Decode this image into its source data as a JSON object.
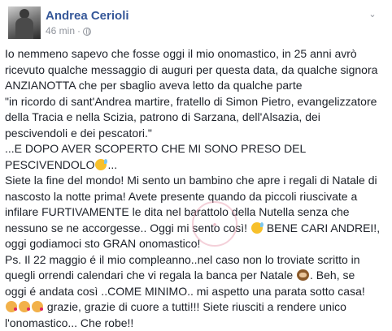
{
  "author": {
    "name": "Andrea Cerioli"
  },
  "meta": {
    "time": "46 min",
    "separator": "·",
    "privacy_icon": "globe-icon"
  },
  "menu": {
    "icon": "chevron-down-icon"
  },
  "post": {
    "lines": [
      "Io nemmeno sapevo che fosse oggi il mio onomastico, in 25 anni avrò",
      "ricevuto qualche messaggio di auguri per questa data, da qualche signora",
      "ANZIANOTTA che per sbaglio aveva letto da qualche parte",
      "\"in ricordo di sant'Andrea martire, fratello di Simon Pietro, evangelizzatore",
      "della Tracia e nella Scizia, patrono di Sarzana, dell'Alsazia, dei",
      "pescivendoli e dei pescatori.\"",
      "...E DOPO AVER SCOPERTO CHE MI SONO PRESO DEL",
      {
        "before": "PESCIVENDOLO",
        "emoji": "sweat-smile-emoji",
        "after": "..."
      },
      "Siete la fine del mondo! Mi sento un bambino che apre i regali di Natale di",
      "nascosto la notte prima! Avete presente quando da piccoli riuscivate a",
      "infilare FURTIVAMENTE le dita nel barattolo della Nutella senza che",
      {
        "before": "nessuno se ne accorgesse.. Oggi mi sento così! ",
        "emoji": "sweat-smile-emoji",
        "after": " BENE CARI ANDREI!,"
      },
      "oggi godiamoci sto GRAN onomastico!",
      "Ps. Il 22 maggio é il mio compleanno..nel caso non lo troviate scritto in",
      {
        "before": "quegli orrendi calendari che vi regala la banca per Natale ",
        "emoji": "see-no-evil-monkey-emoji",
        "after": ". Beh, se"
      },
      "oggi é andata così ..COME MINIMO.. mi aspetto una parata sotto casa!",
      {
        "before": "",
        "emoji": "kiss-emoji",
        "count": 3,
        "after": " grazie, grazie di cuore a tutti!!! Siete riusciti a rendere unico"
      },
      "l'onomastico... Che robe!!"
    ]
  },
  "colors": {
    "name": "#365899",
    "text": "#1d2129",
    "meta": "#90949c"
  }
}
